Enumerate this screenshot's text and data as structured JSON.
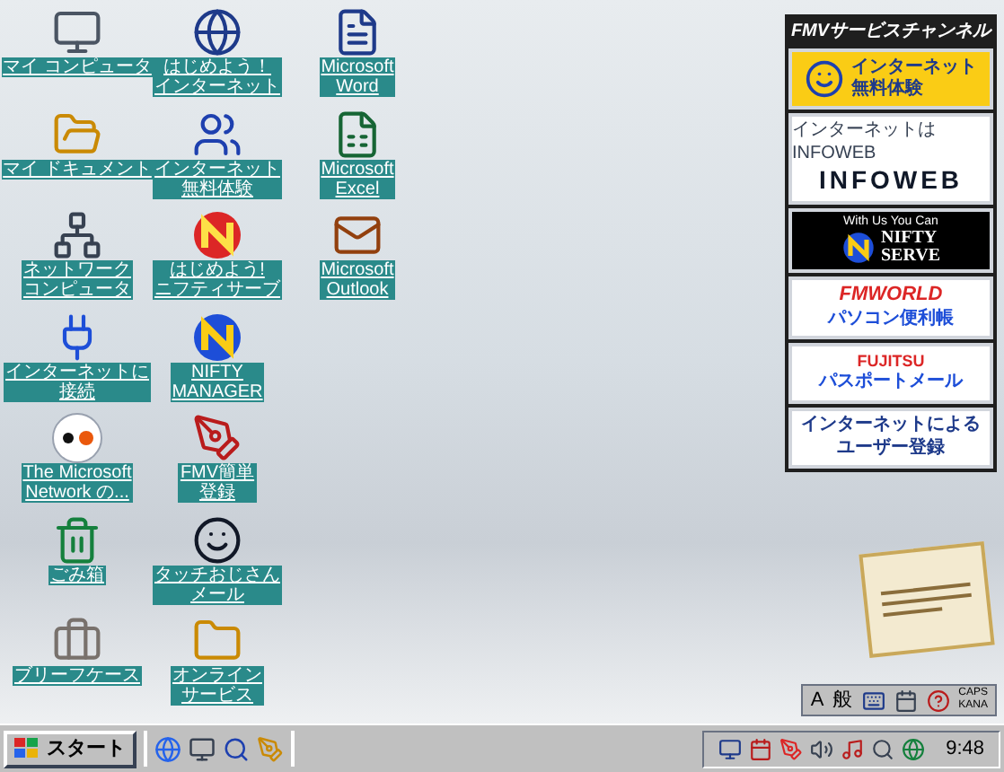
{
  "desktop_icons": [
    {
      "kind": "computer",
      "lines": [
        "マイ コンピュータ"
      ]
    },
    {
      "kind": "folder-docs",
      "lines": [
        "マイ ドキュメント"
      ]
    },
    {
      "kind": "network",
      "lines": [
        "ネットワーク",
        "コンピュータ"
      ]
    },
    {
      "kind": "connect",
      "lines": [
        "インターネットに",
        "接続"
      ]
    },
    {
      "kind": "msn",
      "lines": [
        "The Microsoft",
        "Network の..."
      ]
    },
    {
      "kind": "trash",
      "lines": [
        "ごみ箱"
      ]
    },
    {
      "kind": "briefcase",
      "lines": [
        "ブリーフケース"
      ]
    },
    {
      "kind": "globe",
      "lines": [
        "はじめよう！",
        "インターネット"
      ]
    },
    {
      "kind": "people",
      "lines": [
        "インターネット",
        "無料体験"
      ]
    },
    {
      "kind": "nifty-red",
      "lines": [
        "はじめよう!",
        "ニフティサーブ"
      ]
    },
    {
      "kind": "nifty",
      "lines": [
        "NIFTY",
        "MANAGER"
      ]
    },
    {
      "kind": "register",
      "lines": [
        "FMV簡単",
        "登録"
      ]
    },
    {
      "kind": "face",
      "lines": [
        "タッチおじさん",
        "メール"
      ]
    },
    {
      "kind": "folder",
      "lines": [
        "オンライン",
        "サービス"
      ]
    },
    {
      "kind": "word",
      "lines": [
        "Microsoft",
        "Word"
      ]
    },
    {
      "kind": "excel",
      "lines": [
        "Microsoft",
        "Excel"
      ]
    },
    {
      "kind": "outlook",
      "lines": [
        "Microsoft",
        "Outlook"
      ]
    }
  ],
  "banner_panel": {
    "header": "FMVサービスチャンネル",
    "banners": [
      {
        "kind": "mascot",
        "lines": [
          "インターネット",
          "無料体験"
        ]
      },
      {
        "kind": "infoweb",
        "lines": [
          "インターネットはINFOWEB",
          "INFOWEB"
        ]
      },
      {
        "kind": "nifty",
        "lines": [
          "With Us You Can",
          "NIFTY",
          "SERVE"
        ]
      },
      {
        "kind": "fmworld",
        "lines": [
          "FMWORLD",
          "パソコン便利帳"
        ]
      },
      {
        "kind": "fujitsu",
        "lines": [
          "FUJITSU",
          "パスポートメール"
        ]
      },
      {
        "kind": "register",
        "lines": [
          "インターネットによる",
          "ユーザー登録"
        ]
      }
    ]
  },
  "ime_bar": {
    "input_mode": "A",
    "conversion": "般",
    "caps": "CAPS",
    "kana": "KANA"
  },
  "taskbar": {
    "start": "スタート",
    "clock": "9:48"
  }
}
